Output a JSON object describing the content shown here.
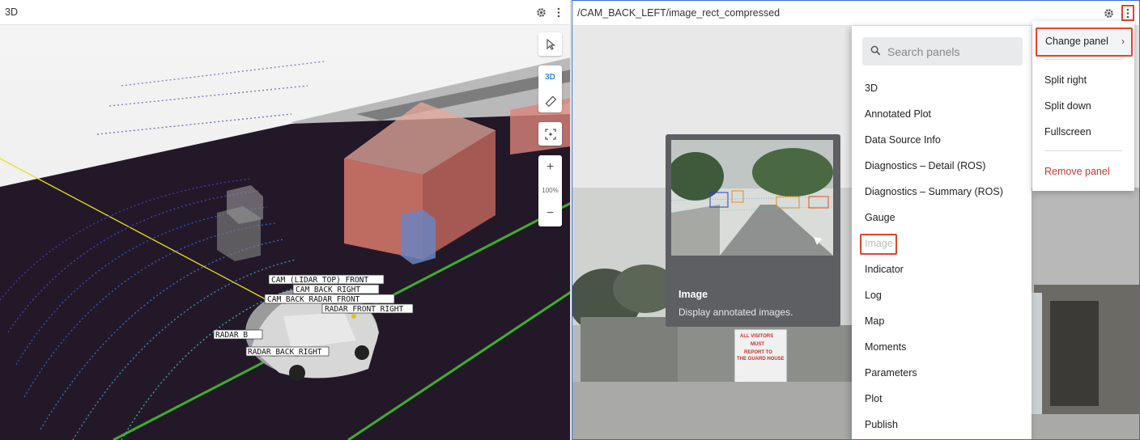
{
  "left_panel": {
    "title": "3D",
    "toolbar": {
      "mode_3d_label": "3D",
      "zoom_level": "100%",
      "zoom_in": "+",
      "zoom_out": "−"
    },
    "scene_labels": [
      "CAM_FRONT",
      "LIDAR_TOP",
      "CAM_BACK_RIGHT",
      "CAM_BACK",
      "RADAR_FRONT_RIGHT",
      "RADAR_BACK_LEFT",
      "RADAR_BACK_RIGHT"
    ]
  },
  "right_panel": {
    "title": "/CAM_BACK_LEFT/image_rect_compressed",
    "sign_text": [
      "ALL VISITORS",
      "MUST",
      "REPORT TO",
      "THE GUARD HOUSE"
    ]
  },
  "panel_menu": {
    "search_placeholder": "Search panels",
    "items": [
      "3D",
      "Annotated Plot",
      "Data Source Info",
      "Diagnostics – Detail (ROS)",
      "Diagnostics – Summary (ROS)",
      "Gauge",
      "Image",
      "Indicator",
      "Log",
      "Map",
      "Moments",
      "Parameters",
      "Plot",
      "Publish"
    ],
    "hovered_item": "Image"
  },
  "tooltip": {
    "title": "Image",
    "description": "Display annotated images."
  },
  "context_menu": {
    "change_panel": "Change panel",
    "split_right": "Split right",
    "split_down": "Split down",
    "fullscreen": "Fullscreen",
    "remove_panel": "Remove panel"
  },
  "colors": {
    "accent_highlight": "#e0462a",
    "remove_red": "#d0362a",
    "panel_focus": "#3a6bd6",
    "mode_3d_blue": "#2d8de0"
  }
}
